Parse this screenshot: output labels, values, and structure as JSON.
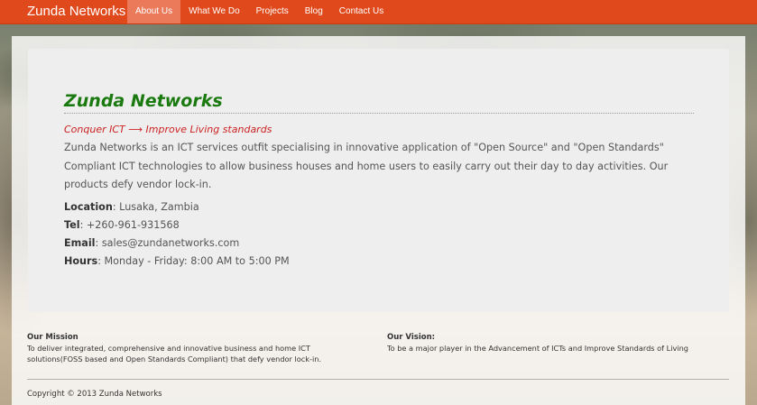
{
  "navbar": {
    "brand": "Zunda Networks",
    "items": [
      {
        "label": "About Us",
        "active": true
      },
      {
        "label": "What We Do",
        "active": false
      },
      {
        "label": "Projects",
        "active": false
      },
      {
        "label": "Blog",
        "active": false
      },
      {
        "label": "Contact Us",
        "active": false
      }
    ],
    "color": "#e0491b",
    "active_color": "#ea7a5a"
  },
  "hero": {
    "title": "Zunda Networks",
    "tagline": "Conquer ICT ⟶ Improve Living standards",
    "description": "Zunda Networks is an ICT services outfit specialising in innovative application of \"Open Source\" and \"Open Standards\" Compliant ICT technologies to allow business houses and home users to easily carry out their day to day activities. Our products defy vendor lock-in.",
    "details": [
      {
        "label": "Location",
        "value": ": Lusaka, Zambia"
      },
      {
        "label": "Tel",
        "value": ": +260-961-931568"
      },
      {
        "label": "Email",
        "value": ": sales@zundanetworks.com"
      },
      {
        "label": "Hours",
        "value": ": Monday - Friday: 8:00 AM to 5:00 PM"
      }
    ],
    "title_color": "#1a7a10",
    "tagline_color": "#cc2222"
  },
  "footer": {
    "mission_heading": "Our Mission",
    "mission_text": "To deliver integrated, comprehensive and innovative business and home ICT solutions(FOSS based and Open Standards Compliant) that defy vendor lock-in.",
    "vision_heading": "Our Vision:",
    "vision_text": "To be a major player in the Advancement of ICTs and Improve Standards of Living",
    "copyright": "Copyright © 2013 Zunda Networks"
  }
}
